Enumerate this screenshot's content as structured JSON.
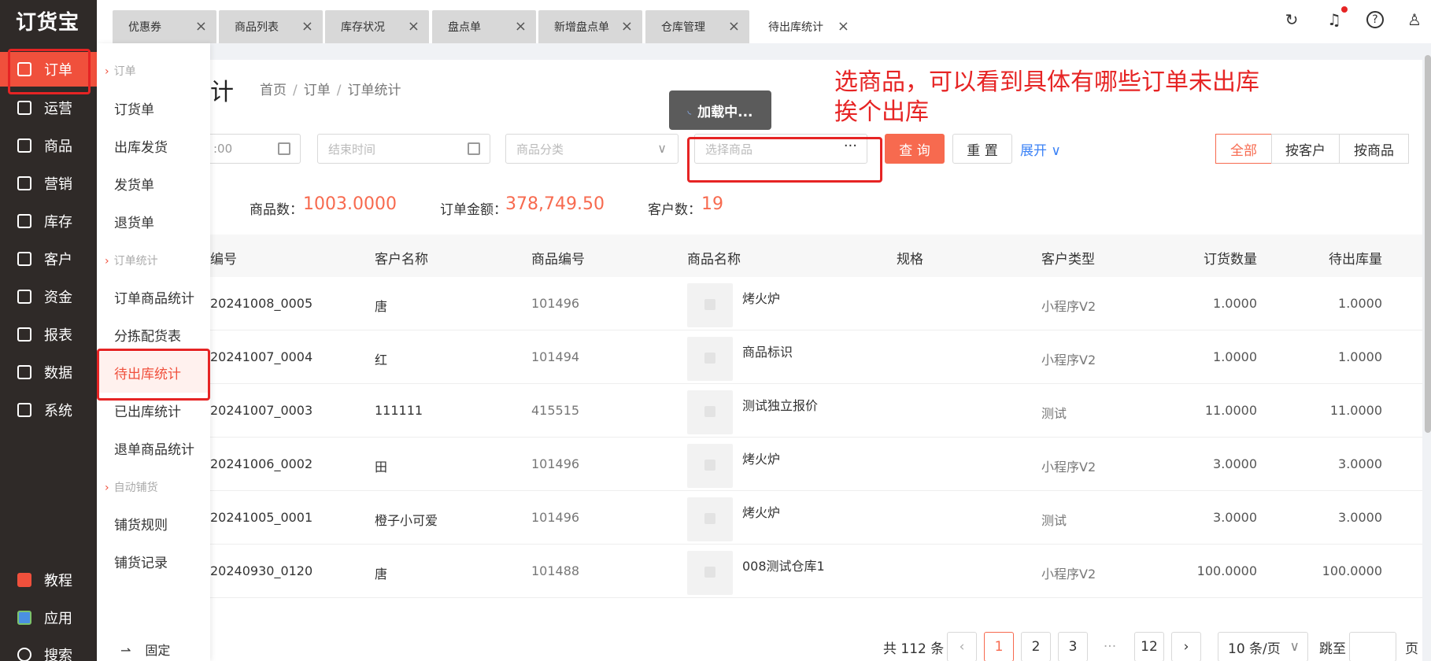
{
  "app": {
    "logo": "订货宝"
  },
  "sidebar": {
    "items": [
      {
        "label": "订单",
        "icon": "order-icon"
      },
      {
        "label": "运营",
        "icon": "operation-icon"
      },
      {
        "label": "商品",
        "icon": "product-icon"
      },
      {
        "label": "营销",
        "icon": "marketing-icon"
      },
      {
        "label": "库存",
        "icon": "inventory-icon"
      },
      {
        "label": "客户",
        "icon": "customer-icon"
      },
      {
        "label": "资金",
        "icon": "finance-icon"
      },
      {
        "label": "报表",
        "icon": "report-icon"
      },
      {
        "label": "数据",
        "icon": "data-icon"
      },
      {
        "label": "系统",
        "icon": "system-icon"
      }
    ],
    "bottom": [
      {
        "label": "教程",
        "icon": "tutorial-icon"
      },
      {
        "label": "应用",
        "icon": "apps-icon"
      },
      {
        "label": "搜索",
        "icon": "search-icon"
      }
    ]
  },
  "submenu": {
    "group_order": "订单",
    "order_items": [
      "订货单",
      "出库发货",
      "发货单",
      "退货单"
    ],
    "group_stats": "订单统计",
    "stats_items": [
      "订单商品统计",
      "分拣配货表",
      "待出库统计",
      "已出库统计",
      "退单商品统计"
    ],
    "group_auto": "自动铺货",
    "auto_items": [
      "铺货规则",
      "铺货记录"
    ],
    "pin_label": "固定",
    "active_color": "#f0503c"
  },
  "tabs": [
    "优惠券",
    "商品列表",
    "库存状况",
    "盘点单",
    "新增盘点单",
    "仓库管理",
    "待出库统计"
  ],
  "page": {
    "title": "计",
    "breadcrumb": [
      "首页",
      "订单",
      "订单统计"
    ]
  },
  "filters": {
    "start_time": ":00",
    "end_time_placeholder": "结束时间",
    "category_placeholder": "商品分类",
    "product_placeholder": "选择商品",
    "query_label": "查 询",
    "reset_label": "重 置",
    "expand_label": "展开",
    "segments": [
      "全部",
      "按客户",
      "按商品"
    ]
  },
  "loading_text": "加载中...",
  "annotation": [
    "选商品，可以看到具体有哪些订单未出库",
    "挨个出库"
  ],
  "stats": {
    "product_count_label": "商品数：",
    "product_count": "1003.0000",
    "order_amount_label": "订单金额：",
    "order_amount": "378,749.50",
    "customer_count_label": "客户数：",
    "customer_count": "19"
  },
  "table": {
    "headers": [
      "编号",
      "客户名称",
      "商品编号",
      "商品名称",
      "规格",
      "客户类型",
      "订货数量",
      "待出库量"
    ],
    "rows": [
      {
        "no": "20241008_0005",
        "customer": "唐",
        "code": "101496",
        "name": "烤火炉",
        "spec": "",
        "type": "小程序V2",
        "qty": "1.0000",
        "pending": "1.0000"
      },
      {
        "no": "20241007_0004",
        "customer": "红",
        "code": "101494",
        "name": "商品标识",
        "spec": "",
        "type": "小程序V2",
        "qty": "1.0000",
        "pending": "1.0000"
      },
      {
        "no": "20241007_0003",
        "customer": "111111",
        "code": "415515",
        "name": "测试独立报价",
        "spec": "",
        "type": "测试",
        "qty": "11.0000",
        "pending": "11.0000"
      },
      {
        "no": "20241006_0002",
        "customer": "田",
        "code": "101496",
        "name": "烤火炉",
        "spec": "",
        "type": "小程序V2",
        "qty": "3.0000",
        "pending": "3.0000"
      },
      {
        "no": "20241005_0001",
        "customer": "橙子小可爱",
        "code": "101496",
        "name": "烤火炉",
        "spec": "",
        "type": "测试",
        "qty": "3.0000",
        "pending": "3.0000"
      },
      {
        "no": "20240930_0120",
        "customer": "唐",
        "code": "101488",
        "name": "008测试仓库1",
        "spec": "",
        "type": "小程序V2",
        "qty": "100.0000",
        "pending": "100.0000"
      }
    ]
  },
  "pagination": {
    "total": "共 112 条",
    "pages": [
      "1",
      "2",
      "3",
      "···",
      "12"
    ],
    "page_size": "10 条/页",
    "jump_label": "跳至",
    "page_suffix": "页"
  }
}
